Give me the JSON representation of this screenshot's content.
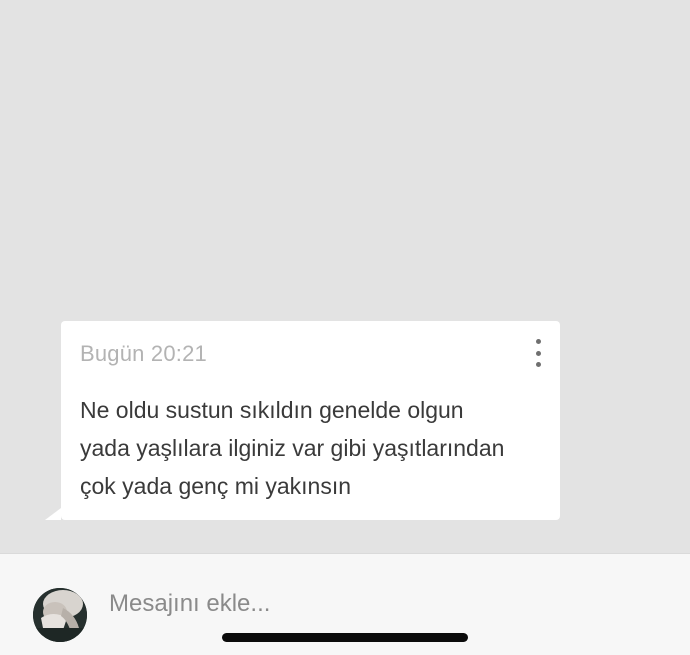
{
  "message": {
    "timestamp": "Bugün 20:21",
    "lines": [
      "Ne oldu sustun sıkıldın genelde olgun",
      "yada yaşlılara ilginiz var gibi yaşıtlarından",
      "çok yada genç mi yakınsın"
    ],
    "menu_icon": "more-vertical-icon"
  },
  "composer": {
    "placeholder": "Mesajını ekle...",
    "avatar_icon": "user-avatar"
  },
  "colors": {
    "background": "#e3e3e3",
    "bubble": "#ffffff",
    "timestamp": "#b3b3b3",
    "text": "#3a3a3a",
    "input_bar": "#f7f7f7"
  }
}
